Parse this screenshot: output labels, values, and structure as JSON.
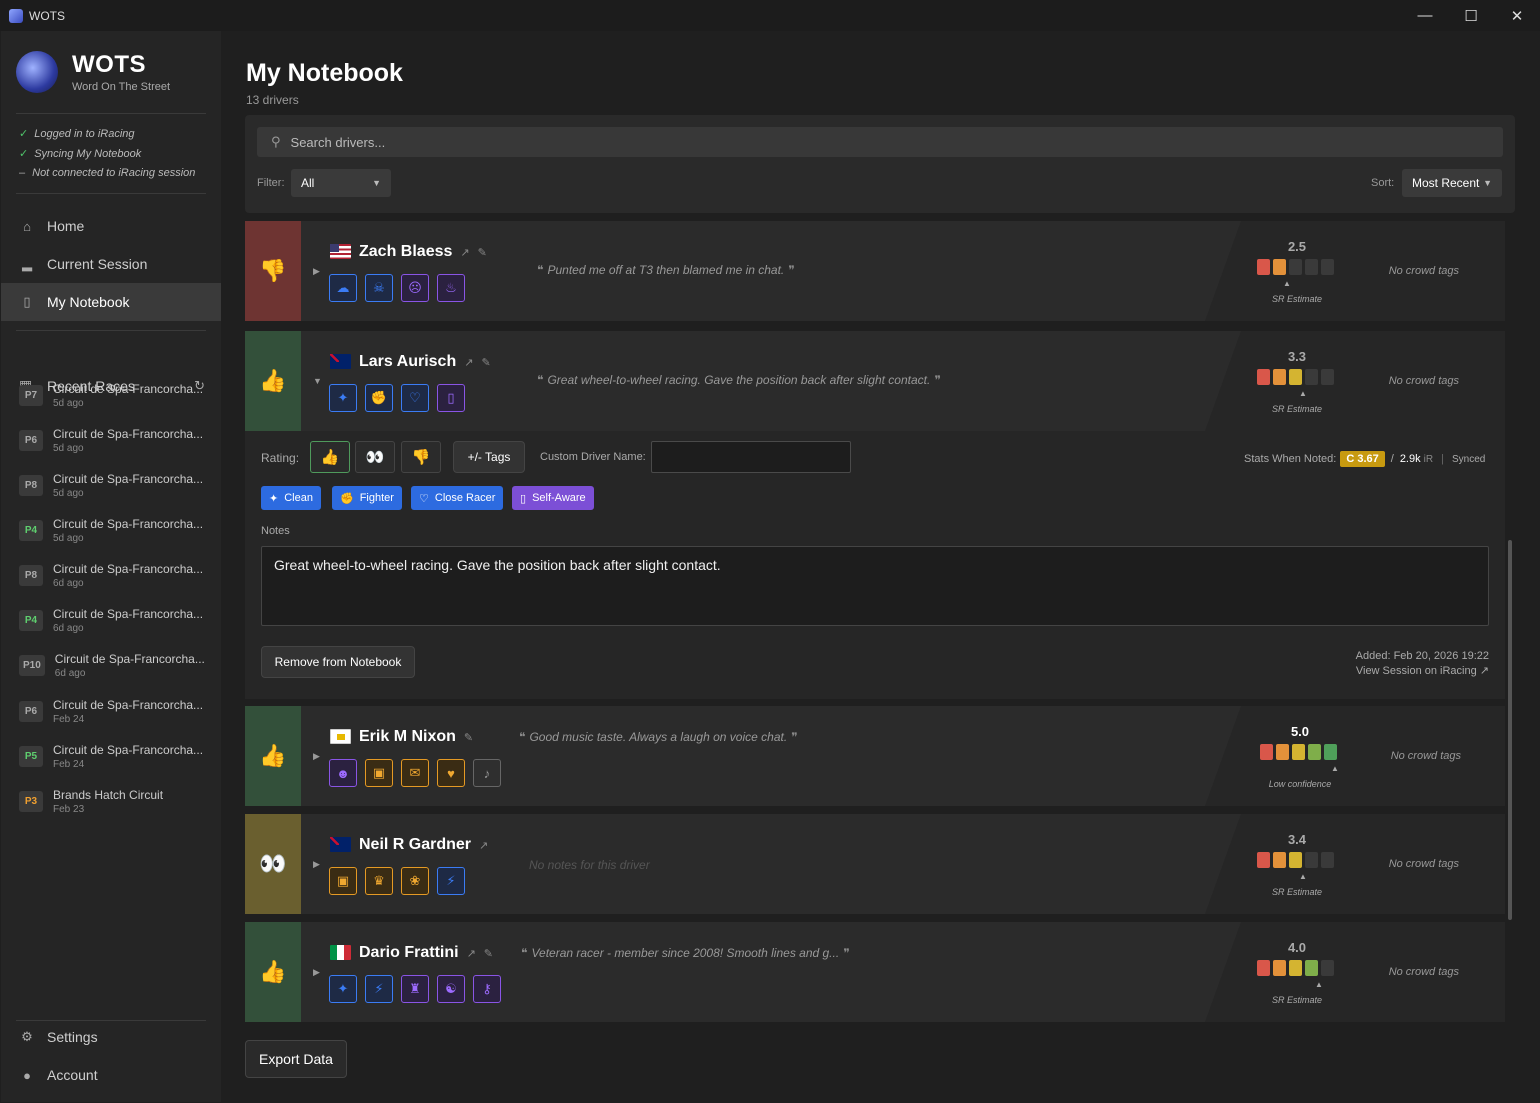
{
  "window": {
    "title": "WOTS",
    "minimize": "—",
    "maximize": "☐",
    "close": "✕"
  },
  "brand": {
    "name": "WOTS",
    "subtitle": "Word On The Street"
  },
  "status": [
    {
      "mark": "✓",
      "text": "Logged in to iRacing"
    },
    {
      "mark": "✓",
      "text": "Syncing My Notebook"
    },
    {
      "mark": "–",
      "text": "Not connected to iRacing session"
    }
  ],
  "nav": {
    "home": "Home",
    "current_session": "Current Session",
    "my_notebook": "My Notebook",
    "recent_races": "Recent Races",
    "settings": "Settings",
    "account": "Account"
  },
  "recent_races": [
    {
      "pos": "P7",
      "track": "Circuit de Spa-Francorcha...",
      "when": "5d ago"
    },
    {
      "pos": "P6",
      "track": "Circuit de Spa-Francorcha...",
      "when": "5d ago"
    },
    {
      "pos": "P8",
      "track": "Circuit de Spa-Francorcha...",
      "when": "5d ago"
    },
    {
      "pos": "P4",
      "track": "Circuit de Spa-Francorcha...",
      "when": "5d ago"
    },
    {
      "pos": "P8",
      "track": "Circuit de Spa-Francorcha...",
      "when": "6d ago"
    },
    {
      "pos": "P4",
      "track": "Circuit de Spa-Francorcha...",
      "when": "6d ago"
    },
    {
      "pos": "P10",
      "track": "Circuit de Spa-Francorcha...",
      "when": "6d ago"
    },
    {
      "pos": "P6",
      "track": "Circuit de Spa-Francorcha...",
      "when": "Feb 24"
    },
    {
      "pos": "P5",
      "track": "Circuit de Spa-Francorcha...",
      "when": "Feb 24"
    },
    {
      "pos": "P3",
      "track": "Brands Hatch Circuit",
      "when": "Feb 23"
    }
  ],
  "page": {
    "title": "My Notebook",
    "count": "13 drivers"
  },
  "search": {
    "placeholder": "Search drivers..."
  },
  "filter": {
    "label": "Filter:",
    "value": "All"
  },
  "sort": {
    "label": "Sort:",
    "value": "Most Recent"
  },
  "drivers": [
    {
      "name": "Zach Blaess",
      "note": "Punted me off at T3 then blamed me in chat.",
      "sr": "2.5",
      "sr_label": "SR Estimate",
      "crowd": "No crowd tags"
    },
    {
      "name": "Lars Aurisch",
      "note": "Great wheel-to-wheel racing. Gave the position back after slight contact.",
      "sr": "3.3",
      "sr_label": "SR Estimate",
      "crowd": "No crowd tags"
    },
    {
      "name": "Erik M Nixon",
      "note": "Good music taste. Always a laugh on voice chat.",
      "sr": "5.0",
      "sr_label": "Low confidence",
      "crowd": "No crowd tags"
    },
    {
      "name": "Neil R Gardner",
      "note": "No notes for this driver",
      "sr": "3.4",
      "sr_label": "SR Estimate",
      "crowd": "No crowd tags"
    },
    {
      "name": "Dario Frattini",
      "note": "Veteran racer - member since 2008! Smooth lines and g...",
      "sr": "4.0",
      "sr_label": "SR Estimate",
      "crowd": "No crowd tags"
    }
  ],
  "detail": {
    "rating_label": "Rating:",
    "tags_button": "+/- Tags",
    "custom_name_label": "Custom Driver Name:",
    "custom_name_value": "",
    "stats_label": "Stats When Noted:",
    "license": "C 3.67",
    "slash": "/",
    "irating": "2.9k",
    "ir_unit": "iR",
    "pipe": "|",
    "synced": "Synced",
    "chips": [
      "Clean",
      "Fighter",
      "Close Racer",
      "Self-Aware"
    ],
    "notes_label": "Notes",
    "notes_value": "Great wheel-to-wheel racing. Gave the position back after slight contact.",
    "remove_button": "Remove from Notebook",
    "added": "Added:  Feb 20, 2026 19:22",
    "view_session": "View Session on iRacing ↗"
  },
  "export_button": "Export Data",
  "colors": {
    "accent_blue": "#2d6be0",
    "accent_purple": "#7c4fd6",
    "thumbs_down": "#6e3432",
    "thumbs_up": "#33503a",
    "neutral": "#6a5f2f",
    "license_c": "#c79a10"
  }
}
